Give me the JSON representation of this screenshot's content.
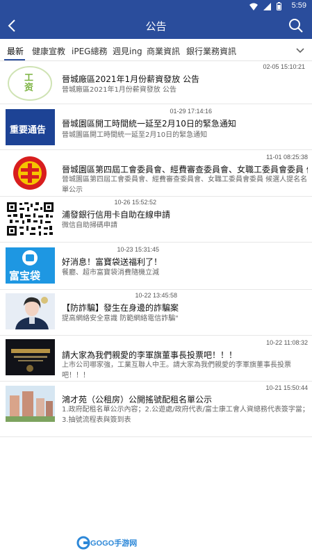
{
  "status_bar": {
    "time": "5:59"
  },
  "header": {
    "title": "公告"
  },
  "tabs": [
    {
      "label": "最新"
    },
    {
      "label": "健康宣教"
    },
    {
      "label": "iPEG總務"
    },
    {
      "label": "週見ing"
    },
    {
      "label": "商業資訊"
    },
    {
      "label": "銀行業務資訊"
    }
  ],
  "items": [
    {
      "thumb_text": "工资",
      "time": "02-05 15:10:21",
      "title": "晉城廠區2021年1月份薪資發放 公告",
      "desc": "晉城廠區2021年1月份薪資發放 公告"
    },
    {
      "thumb_text": "重要通告",
      "time": "01-29 17:14:16",
      "title": "晉城園區開工時間統一延至2月10日的緊急通知",
      "desc": "晉城園區開工時間統一延至2月10日的緊急通知"
    },
    {
      "thumb_text": "",
      "time": "11-01 08:25:38",
      "title": "晉城園區第四屆工會委員會、經費審查委員會、女職工委員會委員 候選人提...",
      "desc": "晉城園區第四屆工會委員會、經費審查委員會、女職工委員會委員 候選人提名名單公示"
    },
    {
      "thumb_text": "",
      "time": "10-26 15:52:52",
      "title": "浦發銀行信用卡自助在線申請",
      "desc": "微信自助掃碼申請"
    },
    {
      "thumb_text": "富宝袋",
      "time": "10-23 15:31:45",
      "title": "好消息！富寶袋送福利了！",
      "desc": "餐廳、超市富寶袋消費隨機立減"
    },
    {
      "thumb_text": "",
      "time": "10-22 13:45:58",
      "title": "【防詐騙】發生在身邊的詐騙案",
      "desc": "提高網絡安全意識 防範網絡電信詐騙\""
    },
    {
      "thumb_text": "",
      "time": "10-22 11:08:32",
      "title": "請大家為我們親愛的李軍旗董事長投票吧！！！",
      "desc": "上市公司哪家強，工業互聯人中王。請大家為我們親愛的李軍旗董事長投票吧！！！"
    },
    {
      "thumb_text": "",
      "time": "10-21 15:50:44",
      "title": "鴻才苑（公租房）公開搖號配租名單公示",
      "desc": "1.政府配租名單公示內容；2.公遊處/政府代表/富士康工會人資總務代表簽字當；3.抽號流程表與簽到表"
    }
  ],
  "footer": {
    "logo_text": "GOGO手游网"
  }
}
